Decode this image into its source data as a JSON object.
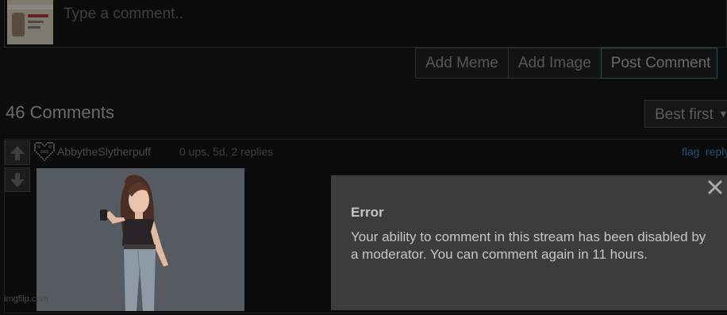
{
  "comment_box": {
    "placeholder": "Type a comment.."
  },
  "actions": {
    "add_meme": "Add Meme",
    "add_image": "Add Image",
    "post_comment": "Post Comment"
  },
  "comments_header": {
    "count_label": "46 Comments",
    "sort_selected": "Best first"
  },
  "comment": {
    "username": "AbbytheSlytherpuff",
    "meta": "0 ups, 5d, 2 replies",
    "flag_label": "flag",
    "reply_label": "reply"
  },
  "watermark": "imgflip.com",
  "error_dialog": {
    "title": "Error",
    "message": "Your ability to comment in this stream has been disabled by a moderator. You can comment again in 11 hours."
  },
  "icons": {
    "vote_up": "arrow-up-icon",
    "vote_down": "arrow-down-icon",
    "user_avatar": "pixel-heart-icon",
    "close": "close-icon",
    "sort_caret": "caret-down-icon"
  },
  "colors": {
    "background": "#0d0d0d",
    "dialog_bg": "#3c3c3c",
    "link": "#1f4f78"
  }
}
